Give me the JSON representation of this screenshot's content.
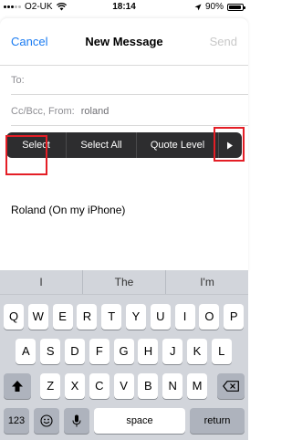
{
  "status": {
    "carrier": "O2-UK",
    "time": "18:14",
    "battery_percent": "90%",
    "battery_level": 0.9,
    "signal_bars": 3,
    "signal_total": 5
  },
  "compose": {
    "cancel_label": "Cancel",
    "title": "New Message",
    "send_label": "Send",
    "to_label": "To:",
    "ccbcc_label": "Cc/Bcc, From:",
    "from_value": "roland"
  },
  "callout": {
    "select": "Select",
    "select_all": "Select All",
    "quote_level": "Quote Level"
  },
  "body": {
    "signature": "Roland (On my iPhone)"
  },
  "keyboard": {
    "suggestions": [
      "I",
      "The",
      "I'm"
    ],
    "row1": [
      "Q",
      "W",
      "E",
      "R",
      "T",
      "Y",
      "U",
      "I",
      "O",
      "P"
    ],
    "row2": [
      "A",
      "S",
      "D",
      "F",
      "G",
      "H",
      "J",
      "K",
      "L"
    ],
    "row3": [
      "Z",
      "X",
      "C",
      "V",
      "B",
      "N",
      "M"
    ],
    "numbers_label": "123",
    "space_label": "space",
    "return_label": "return"
  },
  "colors": {
    "accent": "#1a7bf2",
    "highlight": "#e41e26"
  }
}
